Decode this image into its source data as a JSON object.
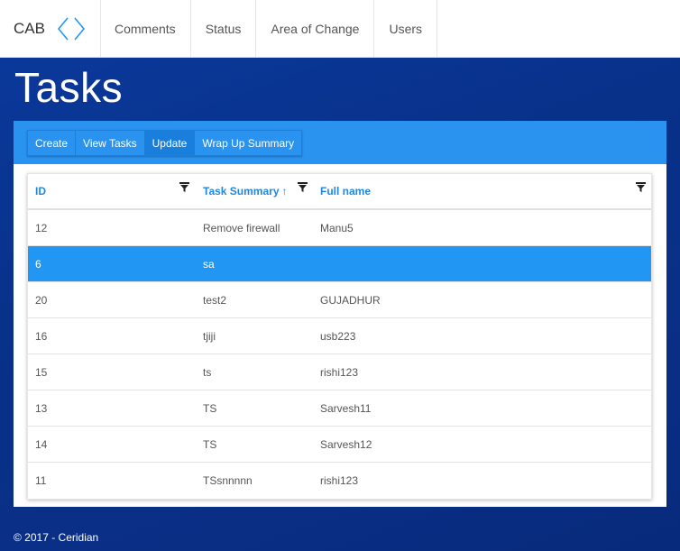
{
  "brand": {
    "name": "CAB",
    "logo_icon": "diamond-chevrons-icon",
    "accent": "#2196f3"
  },
  "nav": [
    {
      "label": "Comments"
    },
    {
      "label": "Status"
    },
    {
      "label": "Area of Change"
    },
    {
      "label": "Users"
    }
  ],
  "page": {
    "title": "Tasks"
  },
  "toolbar": {
    "buttons": [
      {
        "label": "Create"
      },
      {
        "label": "View Tasks"
      },
      {
        "label": "Update"
      },
      {
        "label": "Wrap Up Summary"
      }
    ],
    "active_button": "Update"
  },
  "grid": {
    "columns": [
      {
        "label": "ID",
        "filter_icon": "filter-icon"
      },
      {
        "label": "Task Summary",
        "sort": "↑",
        "filter_icon": "filter-icon"
      },
      {
        "label": "Full name",
        "filter_icon": "filter-icon"
      }
    ],
    "rows": [
      {
        "id": "12",
        "task_summary": "Remove firewall",
        "full_name": "Manu5"
      },
      {
        "id": "6",
        "task_summary": "sa",
        "full_name": ""
      },
      {
        "id": "20",
        "task_summary": "test2",
        "full_name": "GUJADHUR"
      },
      {
        "id": "16",
        "task_summary": "tjiji",
        "full_name": "usb223"
      },
      {
        "id": "15",
        "task_summary": "ts",
        "full_name": "rishi123"
      },
      {
        "id": "13",
        "task_summary": "TS",
        "full_name": "Sarvesh11"
      },
      {
        "id": "14",
        "task_summary": "TS",
        "full_name": "Sarvesh12"
      },
      {
        "id": "11",
        "task_summary": "TSsnnnnn",
        "full_name": "rishi123"
      }
    ],
    "selected_row_id": "6"
  },
  "footer": {
    "text": "© 2017 - Ceridian"
  }
}
